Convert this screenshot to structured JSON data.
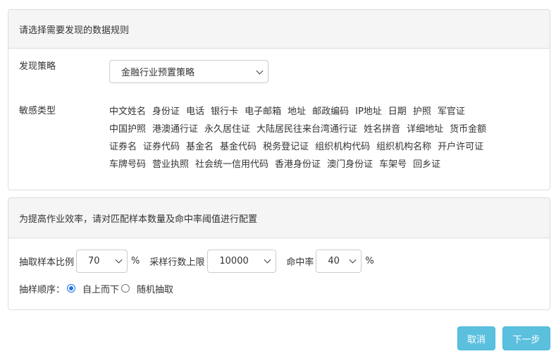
{
  "rules_panel": {
    "title": "请选择需要发现的数据规则",
    "strategy_label": "发现策略",
    "strategy_value": "金融行业预置策略",
    "types_label": "敏感类型",
    "types": [
      [
        "中文姓名",
        "身份证",
        "电话",
        "银行卡",
        "电子邮箱",
        "地址",
        "邮政编码",
        "IP地址",
        "日期",
        "护照",
        "军官证"
      ],
      [
        "中国护照",
        "港澳通行证",
        "永久居住证",
        "大陆居民往来台湾通行证",
        "姓名拼音",
        "详细地址",
        "货币金额"
      ],
      [
        "证券名",
        "证券代码",
        "基金名",
        "基金代码",
        "税务登记证",
        "组织机构代码",
        "组织机构名称",
        "开户许可证"
      ],
      [
        "车牌号码",
        "营业执照",
        "社会统一信用代码",
        "香港身份证",
        "澳门身份证",
        "车架号",
        "回乡证"
      ]
    ]
  },
  "config_panel": {
    "title": "为提高作业效率，请对匹配样本数量及命中率阈值进行配置",
    "sample_ratio_label": "抽取样本比例",
    "sample_ratio_value": "70",
    "percent_sign": "%",
    "row_limit_label": "采样行数上限",
    "row_limit_value": "10000",
    "hit_rate_label": "命中率",
    "hit_rate_value": "40",
    "order_label": "抽样顺序：",
    "order_options": [
      {
        "label": "自上而下",
        "checked": true
      },
      {
        "label": "随机抽取",
        "checked": false
      }
    ]
  },
  "buttons": {
    "cancel": "取消",
    "next": "下一步"
  },
  "colors": {
    "button": "#5bc0de",
    "radio_checked": "#1a73e8"
  }
}
